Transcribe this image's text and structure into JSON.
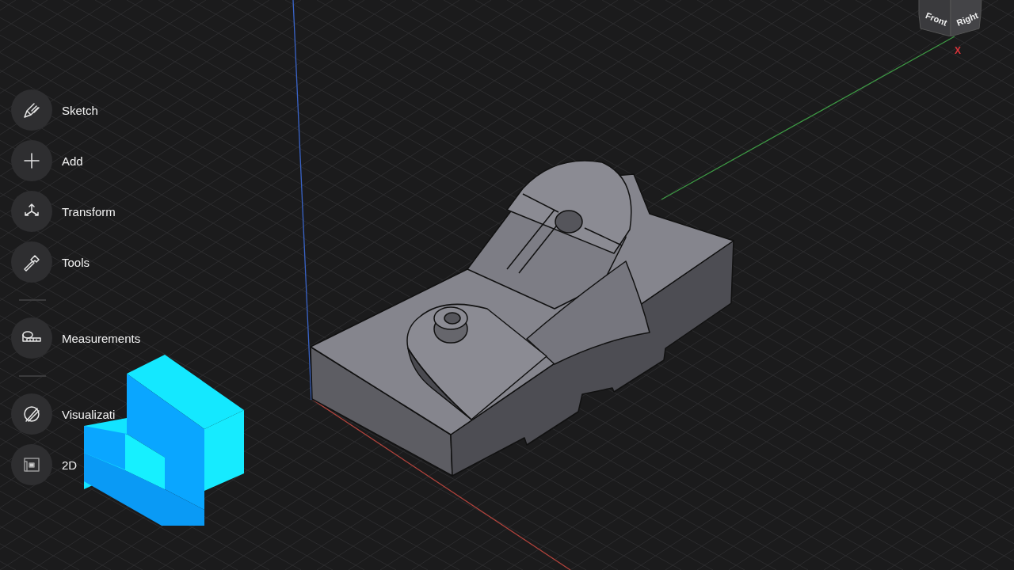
{
  "toolbar": {
    "items": [
      {
        "kind": "tool",
        "label": "Sketch"
      },
      {
        "kind": "tool",
        "label": "Add"
      },
      {
        "kind": "tool",
        "label": "Transform"
      },
      {
        "kind": "tool",
        "label": "Tools"
      },
      {
        "kind": "divider"
      },
      {
        "kind": "tool",
        "label": "Measurements"
      },
      {
        "kind": "divider"
      },
      {
        "kind": "tool",
        "label": "Visualizati"
      },
      {
        "kind": "tool",
        "label": "2D"
      }
    ]
  },
  "view_cube": {
    "faces": [
      "Front",
      "Right"
    ],
    "axis_label": "X"
  }
}
